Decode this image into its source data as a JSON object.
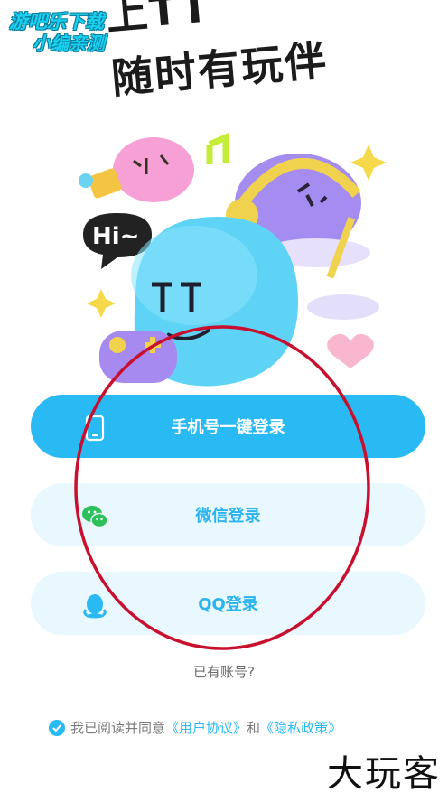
{
  "watermark_top": {
    "line1": "游吧乐下载",
    "line2": "小编亲测"
  },
  "headline": {
    "line1": "上TT",
    "line2": "随时有玩伴"
  },
  "hero": {
    "speech_text": "Hi~"
  },
  "buttons": {
    "phone_login": "手机号一键登录",
    "wechat_login": "微信登录",
    "qq_login": "QQ登录"
  },
  "has_account": "已有账号?",
  "agreement": {
    "prefix": "我已阅读并同意",
    "user_agreement": "《用户协议》",
    "and": "和",
    "privacy_policy": "《隐私政策》"
  },
  "watermark_bottom": "大玩客",
  "colors": {
    "primary": "#29b9f3",
    "secondary_bg": "#e9f7fe",
    "annotation": "#c8102e"
  }
}
